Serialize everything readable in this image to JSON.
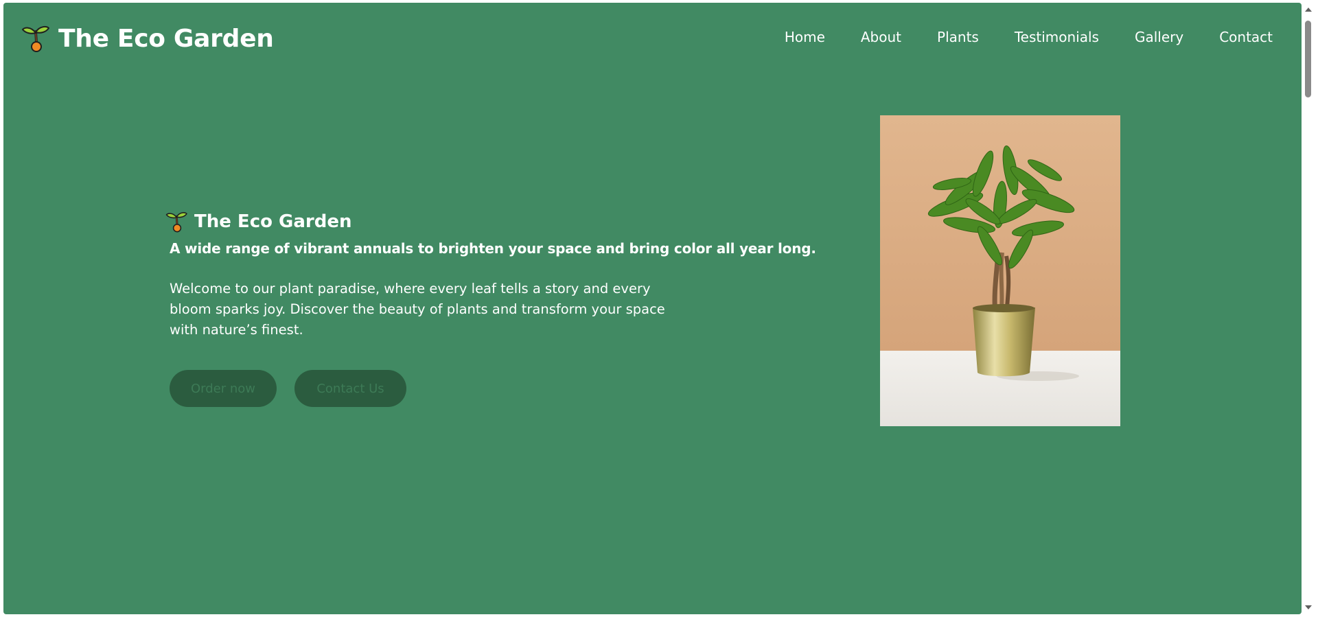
{
  "header": {
    "brand": "The Eco Garden",
    "logo_icon": "sprout-icon",
    "nav": [
      {
        "label": "Home"
      },
      {
        "label": "About"
      },
      {
        "label": "Plants"
      },
      {
        "label": "Testimonials"
      },
      {
        "label": "Gallery"
      },
      {
        "label": "Contact"
      }
    ]
  },
  "hero": {
    "title": "The Eco Garden",
    "title_icon": "sprout-icon",
    "tagline": "A wide range of vibrant annuals to brighten your space and bring color all year long.",
    "description": "Welcome to our plant paradise, where every leaf tells a story and every bloom sparks joy. Discover the beauty of plants and transform your space with nature’s finest.",
    "buttons": {
      "order": "Order now",
      "contact": "Contact Us"
    },
    "image": "money-tree-plant-in-gold-pot"
  },
  "colors": {
    "page_background": "#418a63",
    "button_background": "#2b5c3f",
    "button_text": "#3d7a56",
    "text": "#ffffff"
  }
}
